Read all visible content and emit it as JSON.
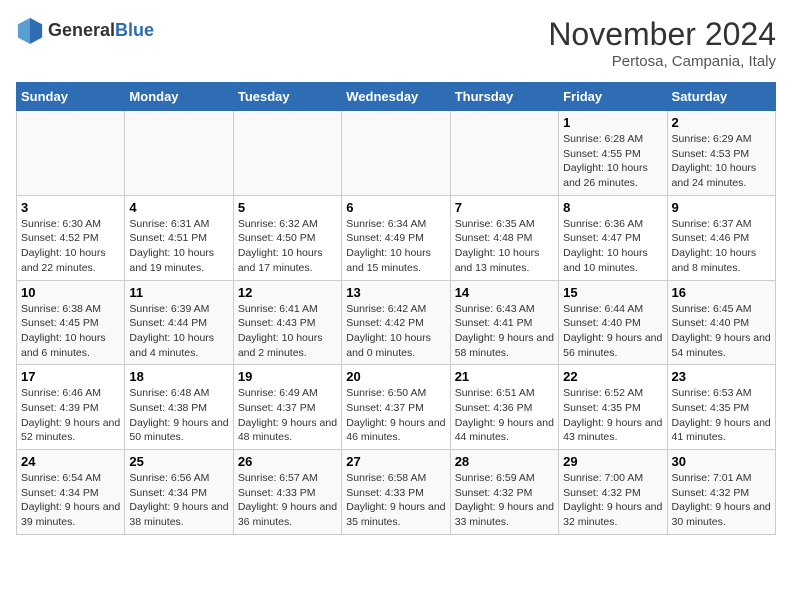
{
  "header": {
    "logo_general": "General",
    "logo_blue": "Blue",
    "title": "November 2024",
    "subtitle": "Pertosa, Campania, Italy"
  },
  "days_of_week": [
    "Sunday",
    "Monday",
    "Tuesday",
    "Wednesday",
    "Thursday",
    "Friday",
    "Saturday"
  ],
  "weeks": [
    {
      "days": [
        {
          "number": "",
          "sunrise": "",
          "sunset": "",
          "daylight": "",
          "empty": true
        },
        {
          "number": "",
          "sunrise": "",
          "sunset": "",
          "daylight": "",
          "empty": true
        },
        {
          "number": "",
          "sunrise": "",
          "sunset": "",
          "daylight": "",
          "empty": true
        },
        {
          "number": "",
          "sunrise": "",
          "sunset": "",
          "daylight": "",
          "empty": true
        },
        {
          "number": "",
          "sunrise": "",
          "sunset": "",
          "daylight": "",
          "empty": true
        },
        {
          "number": "1",
          "sunrise": "Sunrise: 6:28 AM",
          "sunset": "Sunset: 4:55 PM",
          "daylight": "Daylight: 10 hours and 26 minutes."
        },
        {
          "number": "2",
          "sunrise": "Sunrise: 6:29 AM",
          "sunset": "Sunset: 4:53 PM",
          "daylight": "Daylight: 10 hours and 24 minutes."
        }
      ]
    },
    {
      "days": [
        {
          "number": "3",
          "sunrise": "Sunrise: 6:30 AM",
          "sunset": "Sunset: 4:52 PM",
          "daylight": "Daylight: 10 hours and 22 minutes."
        },
        {
          "number": "4",
          "sunrise": "Sunrise: 6:31 AM",
          "sunset": "Sunset: 4:51 PM",
          "daylight": "Daylight: 10 hours and 19 minutes."
        },
        {
          "number": "5",
          "sunrise": "Sunrise: 6:32 AM",
          "sunset": "Sunset: 4:50 PM",
          "daylight": "Daylight: 10 hours and 17 minutes."
        },
        {
          "number": "6",
          "sunrise": "Sunrise: 6:34 AM",
          "sunset": "Sunset: 4:49 PM",
          "daylight": "Daylight: 10 hours and 15 minutes."
        },
        {
          "number": "7",
          "sunrise": "Sunrise: 6:35 AM",
          "sunset": "Sunset: 4:48 PM",
          "daylight": "Daylight: 10 hours and 13 minutes."
        },
        {
          "number": "8",
          "sunrise": "Sunrise: 6:36 AM",
          "sunset": "Sunset: 4:47 PM",
          "daylight": "Daylight: 10 hours and 10 minutes."
        },
        {
          "number": "9",
          "sunrise": "Sunrise: 6:37 AM",
          "sunset": "Sunset: 4:46 PM",
          "daylight": "Daylight: 10 hours and 8 minutes."
        }
      ]
    },
    {
      "days": [
        {
          "number": "10",
          "sunrise": "Sunrise: 6:38 AM",
          "sunset": "Sunset: 4:45 PM",
          "daylight": "Daylight: 10 hours and 6 minutes."
        },
        {
          "number": "11",
          "sunrise": "Sunrise: 6:39 AM",
          "sunset": "Sunset: 4:44 PM",
          "daylight": "Daylight: 10 hours and 4 minutes."
        },
        {
          "number": "12",
          "sunrise": "Sunrise: 6:41 AM",
          "sunset": "Sunset: 4:43 PM",
          "daylight": "Daylight: 10 hours and 2 minutes."
        },
        {
          "number": "13",
          "sunrise": "Sunrise: 6:42 AM",
          "sunset": "Sunset: 4:42 PM",
          "daylight": "Daylight: 10 hours and 0 minutes."
        },
        {
          "number": "14",
          "sunrise": "Sunrise: 6:43 AM",
          "sunset": "Sunset: 4:41 PM",
          "daylight": "Daylight: 9 hours and 58 minutes."
        },
        {
          "number": "15",
          "sunrise": "Sunrise: 6:44 AM",
          "sunset": "Sunset: 4:40 PM",
          "daylight": "Daylight: 9 hours and 56 minutes."
        },
        {
          "number": "16",
          "sunrise": "Sunrise: 6:45 AM",
          "sunset": "Sunset: 4:40 PM",
          "daylight": "Daylight: 9 hours and 54 minutes."
        }
      ]
    },
    {
      "days": [
        {
          "number": "17",
          "sunrise": "Sunrise: 6:46 AM",
          "sunset": "Sunset: 4:39 PM",
          "daylight": "Daylight: 9 hours and 52 minutes."
        },
        {
          "number": "18",
          "sunrise": "Sunrise: 6:48 AM",
          "sunset": "Sunset: 4:38 PM",
          "daylight": "Daylight: 9 hours and 50 minutes."
        },
        {
          "number": "19",
          "sunrise": "Sunrise: 6:49 AM",
          "sunset": "Sunset: 4:37 PM",
          "daylight": "Daylight: 9 hours and 48 minutes."
        },
        {
          "number": "20",
          "sunrise": "Sunrise: 6:50 AM",
          "sunset": "Sunset: 4:37 PM",
          "daylight": "Daylight: 9 hours and 46 minutes."
        },
        {
          "number": "21",
          "sunrise": "Sunrise: 6:51 AM",
          "sunset": "Sunset: 4:36 PM",
          "daylight": "Daylight: 9 hours and 44 minutes."
        },
        {
          "number": "22",
          "sunrise": "Sunrise: 6:52 AM",
          "sunset": "Sunset: 4:35 PM",
          "daylight": "Daylight: 9 hours and 43 minutes."
        },
        {
          "number": "23",
          "sunrise": "Sunrise: 6:53 AM",
          "sunset": "Sunset: 4:35 PM",
          "daylight": "Daylight: 9 hours and 41 minutes."
        }
      ]
    },
    {
      "days": [
        {
          "number": "24",
          "sunrise": "Sunrise: 6:54 AM",
          "sunset": "Sunset: 4:34 PM",
          "daylight": "Daylight: 9 hours and 39 minutes."
        },
        {
          "number": "25",
          "sunrise": "Sunrise: 6:56 AM",
          "sunset": "Sunset: 4:34 PM",
          "daylight": "Daylight: 9 hours and 38 minutes."
        },
        {
          "number": "26",
          "sunrise": "Sunrise: 6:57 AM",
          "sunset": "Sunset: 4:33 PM",
          "daylight": "Daylight: 9 hours and 36 minutes."
        },
        {
          "number": "27",
          "sunrise": "Sunrise: 6:58 AM",
          "sunset": "Sunset: 4:33 PM",
          "daylight": "Daylight: 9 hours and 35 minutes."
        },
        {
          "number": "28",
          "sunrise": "Sunrise: 6:59 AM",
          "sunset": "Sunset: 4:32 PM",
          "daylight": "Daylight: 9 hours and 33 minutes."
        },
        {
          "number": "29",
          "sunrise": "Sunrise: 7:00 AM",
          "sunset": "Sunset: 4:32 PM",
          "daylight": "Daylight: 9 hours and 32 minutes."
        },
        {
          "number": "30",
          "sunrise": "Sunrise: 7:01 AM",
          "sunset": "Sunset: 4:32 PM",
          "daylight": "Daylight: 9 hours and 30 minutes."
        }
      ]
    }
  ]
}
